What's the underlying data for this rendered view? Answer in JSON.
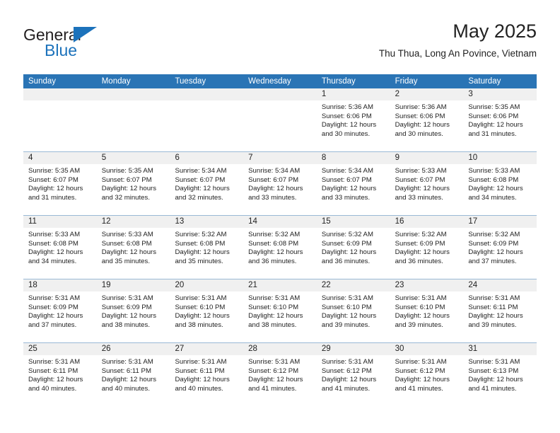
{
  "brand": {
    "name_top": "General",
    "name_bottom": "Blue",
    "accent_color": "#1c72bb",
    "triangle_icon": "brand-triangle-icon"
  },
  "header": {
    "title": "May 2025",
    "subtitle": "Thu Thua, Long An Povince, Vietnam"
  },
  "calendar": {
    "header_bg": "#2a74b5",
    "day_band_bg": "#f0f0f0",
    "weekdays": [
      "Sunday",
      "Monday",
      "Tuesday",
      "Wednesday",
      "Thursday",
      "Friday",
      "Saturday"
    ],
    "weeks": [
      [
        {
          "day": "",
          "sunrise": "",
          "sunset": "",
          "daylight": "",
          "daylight2": "",
          "empty": true
        },
        {
          "day": "",
          "sunrise": "",
          "sunset": "",
          "daylight": "",
          "daylight2": "",
          "empty": true
        },
        {
          "day": "",
          "sunrise": "",
          "sunset": "",
          "daylight": "",
          "daylight2": "",
          "empty": true
        },
        {
          "day": "",
          "sunrise": "",
          "sunset": "",
          "daylight": "",
          "daylight2": "",
          "empty": true
        },
        {
          "day": "1",
          "sunrise": "Sunrise: 5:36 AM",
          "sunset": "Sunset: 6:06 PM",
          "daylight": "Daylight: 12 hours",
          "daylight2": "and 30 minutes."
        },
        {
          "day": "2",
          "sunrise": "Sunrise: 5:36 AM",
          "sunset": "Sunset: 6:06 PM",
          "daylight": "Daylight: 12 hours",
          "daylight2": "and 30 minutes."
        },
        {
          "day": "3",
          "sunrise": "Sunrise: 5:35 AM",
          "sunset": "Sunset: 6:06 PM",
          "daylight": "Daylight: 12 hours",
          "daylight2": "and 31 minutes."
        }
      ],
      [
        {
          "day": "4",
          "sunrise": "Sunrise: 5:35 AM",
          "sunset": "Sunset: 6:07 PM",
          "daylight": "Daylight: 12 hours",
          "daylight2": "and 31 minutes."
        },
        {
          "day": "5",
          "sunrise": "Sunrise: 5:35 AM",
          "sunset": "Sunset: 6:07 PM",
          "daylight": "Daylight: 12 hours",
          "daylight2": "and 32 minutes."
        },
        {
          "day": "6",
          "sunrise": "Sunrise: 5:34 AM",
          "sunset": "Sunset: 6:07 PM",
          "daylight": "Daylight: 12 hours",
          "daylight2": "and 32 minutes."
        },
        {
          "day": "7",
          "sunrise": "Sunrise: 5:34 AM",
          "sunset": "Sunset: 6:07 PM",
          "daylight": "Daylight: 12 hours",
          "daylight2": "and 33 minutes."
        },
        {
          "day": "8",
          "sunrise": "Sunrise: 5:34 AM",
          "sunset": "Sunset: 6:07 PM",
          "daylight": "Daylight: 12 hours",
          "daylight2": "and 33 minutes."
        },
        {
          "day": "9",
          "sunrise": "Sunrise: 5:33 AM",
          "sunset": "Sunset: 6:07 PM",
          "daylight": "Daylight: 12 hours",
          "daylight2": "and 33 minutes."
        },
        {
          "day": "10",
          "sunrise": "Sunrise: 5:33 AM",
          "sunset": "Sunset: 6:08 PM",
          "daylight": "Daylight: 12 hours",
          "daylight2": "and 34 minutes."
        }
      ],
      [
        {
          "day": "11",
          "sunrise": "Sunrise: 5:33 AM",
          "sunset": "Sunset: 6:08 PM",
          "daylight": "Daylight: 12 hours",
          "daylight2": "and 34 minutes."
        },
        {
          "day": "12",
          "sunrise": "Sunrise: 5:33 AM",
          "sunset": "Sunset: 6:08 PM",
          "daylight": "Daylight: 12 hours",
          "daylight2": "and 35 minutes."
        },
        {
          "day": "13",
          "sunrise": "Sunrise: 5:32 AM",
          "sunset": "Sunset: 6:08 PM",
          "daylight": "Daylight: 12 hours",
          "daylight2": "and 35 minutes."
        },
        {
          "day": "14",
          "sunrise": "Sunrise: 5:32 AM",
          "sunset": "Sunset: 6:08 PM",
          "daylight": "Daylight: 12 hours",
          "daylight2": "and 36 minutes."
        },
        {
          "day": "15",
          "sunrise": "Sunrise: 5:32 AM",
          "sunset": "Sunset: 6:09 PM",
          "daylight": "Daylight: 12 hours",
          "daylight2": "and 36 minutes."
        },
        {
          "day": "16",
          "sunrise": "Sunrise: 5:32 AM",
          "sunset": "Sunset: 6:09 PM",
          "daylight": "Daylight: 12 hours",
          "daylight2": "and 36 minutes."
        },
        {
          "day": "17",
          "sunrise": "Sunrise: 5:32 AM",
          "sunset": "Sunset: 6:09 PM",
          "daylight": "Daylight: 12 hours",
          "daylight2": "and 37 minutes."
        }
      ],
      [
        {
          "day": "18",
          "sunrise": "Sunrise: 5:31 AM",
          "sunset": "Sunset: 6:09 PM",
          "daylight": "Daylight: 12 hours",
          "daylight2": "and 37 minutes."
        },
        {
          "day": "19",
          "sunrise": "Sunrise: 5:31 AM",
          "sunset": "Sunset: 6:09 PM",
          "daylight": "Daylight: 12 hours",
          "daylight2": "and 38 minutes."
        },
        {
          "day": "20",
          "sunrise": "Sunrise: 5:31 AM",
          "sunset": "Sunset: 6:10 PM",
          "daylight": "Daylight: 12 hours",
          "daylight2": "and 38 minutes."
        },
        {
          "day": "21",
          "sunrise": "Sunrise: 5:31 AM",
          "sunset": "Sunset: 6:10 PM",
          "daylight": "Daylight: 12 hours",
          "daylight2": "and 38 minutes."
        },
        {
          "day": "22",
          "sunrise": "Sunrise: 5:31 AM",
          "sunset": "Sunset: 6:10 PM",
          "daylight": "Daylight: 12 hours",
          "daylight2": "and 39 minutes."
        },
        {
          "day": "23",
          "sunrise": "Sunrise: 5:31 AM",
          "sunset": "Sunset: 6:10 PM",
          "daylight": "Daylight: 12 hours",
          "daylight2": "and 39 minutes."
        },
        {
          "day": "24",
          "sunrise": "Sunrise: 5:31 AM",
          "sunset": "Sunset: 6:11 PM",
          "daylight": "Daylight: 12 hours",
          "daylight2": "and 39 minutes."
        }
      ],
      [
        {
          "day": "25",
          "sunrise": "Sunrise: 5:31 AM",
          "sunset": "Sunset: 6:11 PM",
          "daylight": "Daylight: 12 hours",
          "daylight2": "and 40 minutes."
        },
        {
          "day": "26",
          "sunrise": "Sunrise: 5:31 AM",
          "sunset": "Sunset: 6:11 PM",
          "daylight": "Daylight: 12 hours",
          "daylight2": "and 40 minutes."
        },
        {
          "day": "27",
          "sunrise": "Sunrise: 5:31 AM",
          "sunset": "Sunset: 6:11 PM",
          "daylight": "Daylight: 12 hours",
          "daylight2": "and 40 minutes."
        },
        {
          "day": "28",
          "sunrise": "Sunrise: 5:31 AM",
          "sunset": "Sunset: 6:12 PM",
          "daylight": "Daylight: 12 hours",
          "daylight2": "and 41 minutes."
        },
        {
          "day": "29",
          "sunrise": "Sunrise: 5:31 AM",
          "sunset": "Sunset: 6:12 PM",
          "daylight": "Daylight: 12 hours",
          "daylight2": "and 41 minutes."
        },
        {
          "day": "30",
          "sunrise": "Sunrise: 5:31 AM",
          "sunset": "Sunset: 6:12 PM",
          "daylight": "Daylight: 12 hours",
          "daylight2": "and 41 minutes."
        },
        {
          "day": "31",
          "sunrise": "Sunrise: 5:31 AM",
          "sunset": "Sunset: 6:13 PM",
          "daylight": "Daylight: 12 hours",
          "daylight2": "and 41 minutes."
        }
      ]
    ]
  }
}
